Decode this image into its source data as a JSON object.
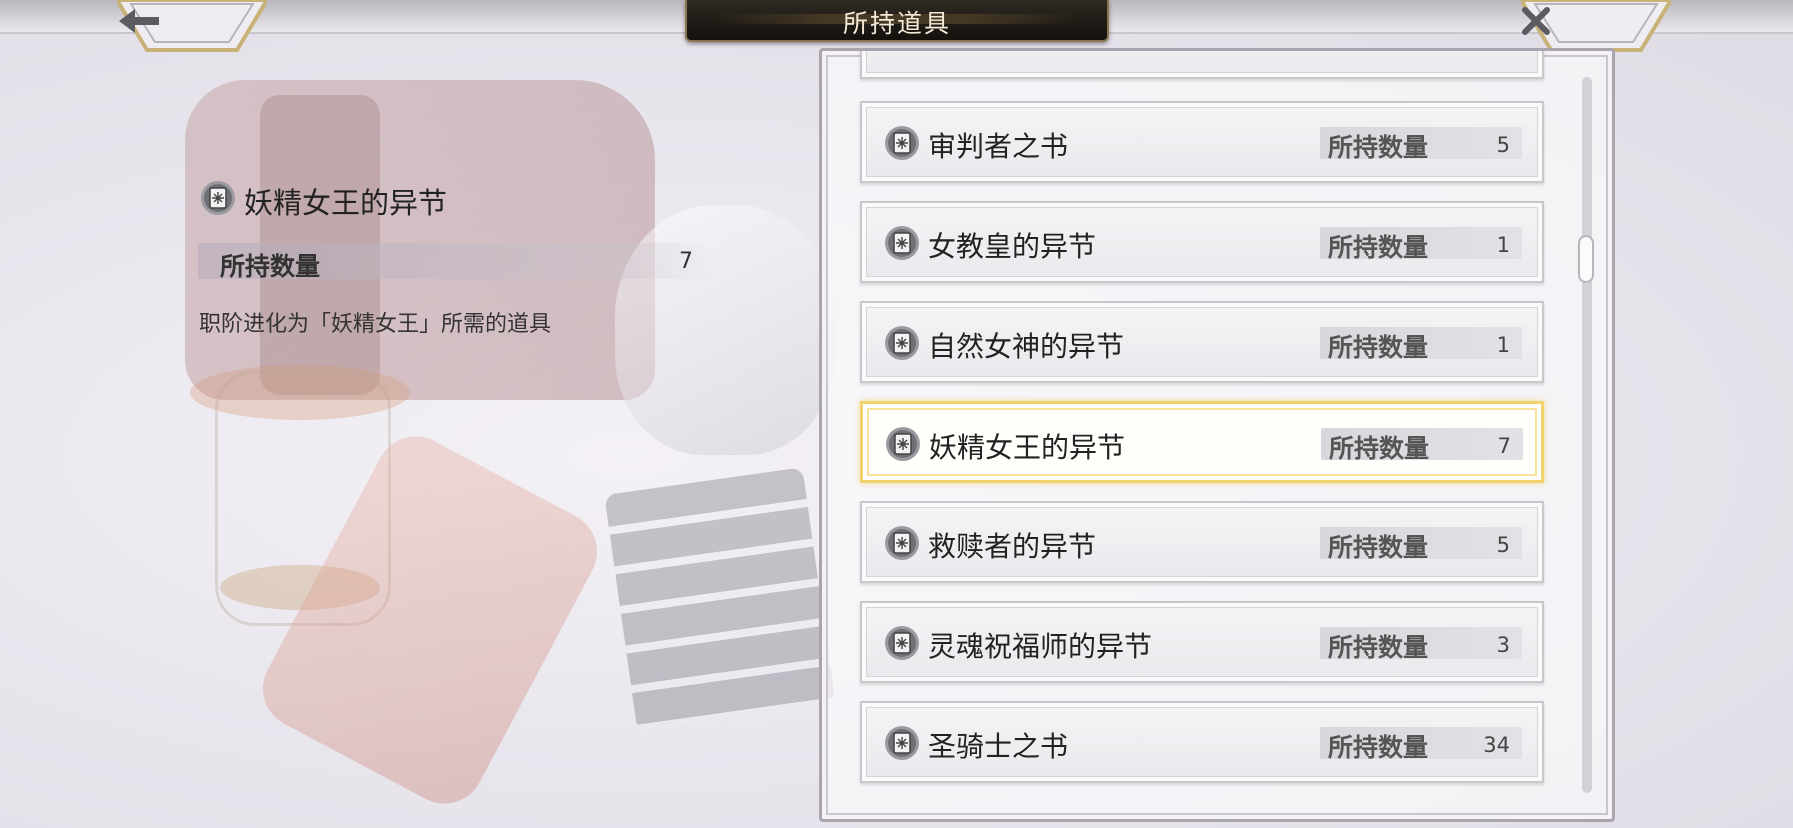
{
  "header": {
    "title": "所持道具",
    "back_icon": "arrow-left-icon",
    "close_icon": "close-icon",
    "back_glyph": "🡐",
    "close_glyph": "✕"
  },
  "detail": {
    "item_name": "妖精女王的异节",
    "qty_label": "所持数量",
    "qty_value": "7",
    "description": "职阶进化为「妖精女王」所需的道具",
    "icon": "book-icon"
  },
  "list": {
    "items": [
      {
        "name": "审判者之书",
        "qty_label": "所持数量",
        "qty": "5",
        "selected": false
      },
      {
        "name": "女教皇的异节",
        "qty_label": "所持数量",
        "qty": "1",
        "selected": false
      },
      {
        "name": "自然女神的异节",
        "qty_label": "所持数量",
        "qty": "1",
        "selected": false
      },
      {
        "name": "妖精女王的异节",
        "qty_label": "所持数量",
        "qty": "7",
        "selected": true
      },
      {
        "name": "救赎者的异节",
        "qty_label": "所持数量",
        "qty": "5",
        "selected": false
      },
      {
        "name": "灵魂祝福师的异节",
        "qty_label": "所持数量",
        "qty": "3",
        "selected": false
      },
      {
        "name": "圣骑士之书",
        "qty_label": "所持数量",
        "qty": "34",
        "selected": false
      }
    ]
  },
  "colors": {
    "selected_border": "#f0d36a",
    "title_plate": "#1d1913",
    "title_text": "#f4ead7"
  }
}
